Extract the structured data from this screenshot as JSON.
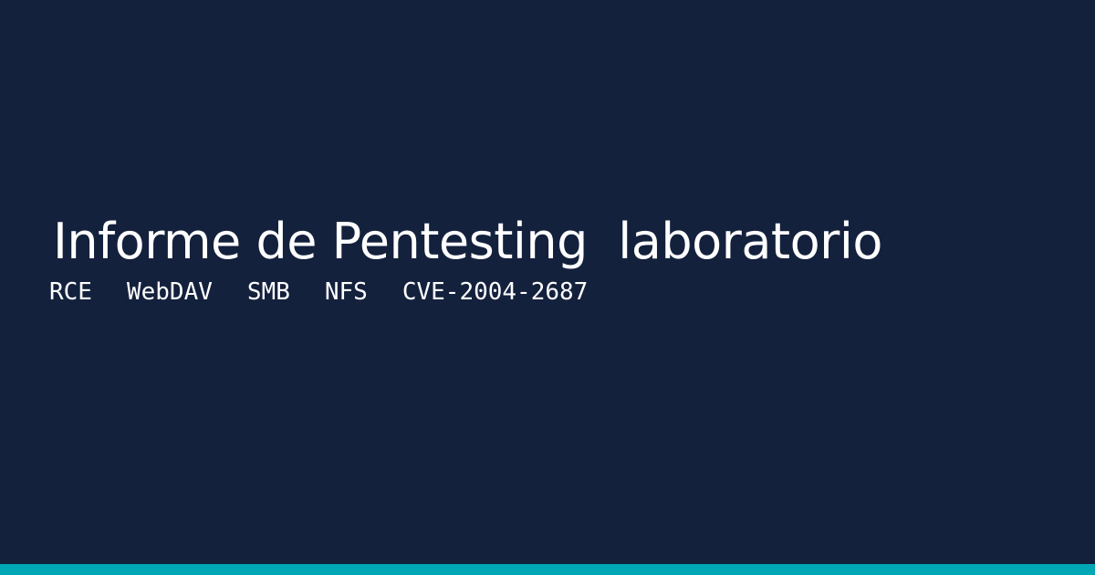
{
  "title": "Informe de Pentesting  laboratorio",
  "tags": [
    "RCE",
    "WebDAV",
    "SMB",
    "NFS",
    "CVE-2004-2687"
  ],
  "colors": {
    "background": "#14213d",
    "text": "#ffffff",
    "accent": "#00a8b5"
  }
}
